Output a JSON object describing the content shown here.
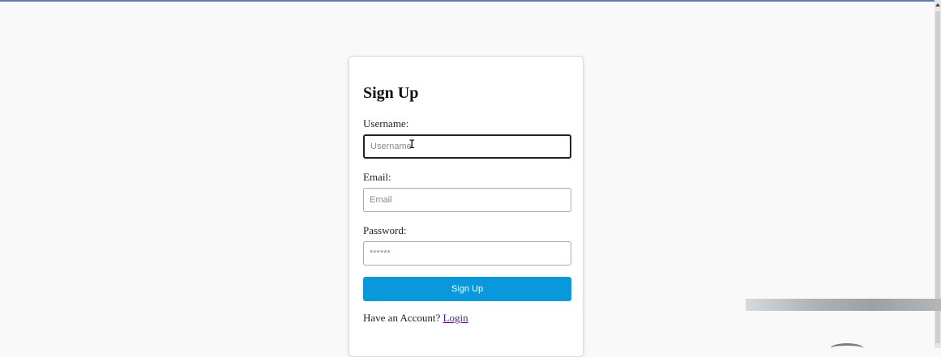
{
  "form": {
    "title": "Sign Up",
    "username_label": "Username:",
    "username_placeholder": "Username",
    "email_label": "Email:",
    "email_placeholder": "Email",
    "password_label": "Password:",
    "password_placeholder": "******",
    "submit_label": "Sign Up",
    "footer_text": "Have an Account?",
    "login_link": "Login"
  },
  "colors": {
    "accent": "#0a98dc",
    "link": "#551a8b"
  },
  "icons": {
    "cursor": "text-cursor-icon"
  }
}
